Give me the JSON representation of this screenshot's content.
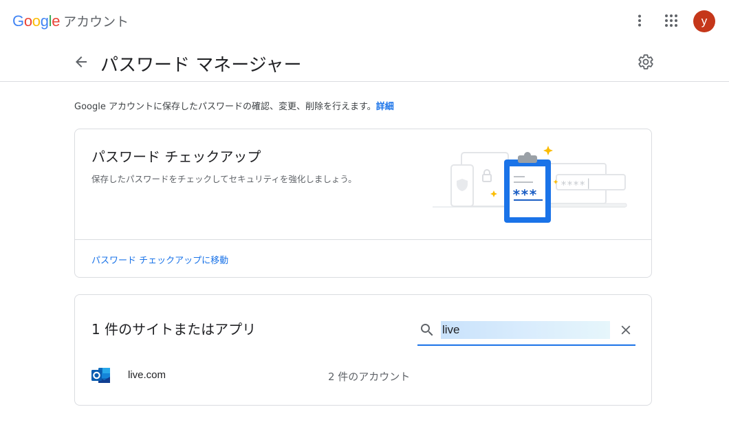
{
  "topbar": {
    "logo_letters": [
      "G",
      "o",
      "o",
      "g",
      "l",
      "e"
    ],
    "product": "アカウント",
    "avatar_letter": "y",
    "icons": [
      "more-vert-icon",
      "apps-grid-icon"
    ]
  },
  "header": {
    "title": "パスワード マネージャー",
    "icons": [
      "arrow-back-icon",
      "gear-icon"
    ]
  },
  "description": {
    "text": "Google アカウントに保存したパスワードの確認、変更、削除を行えます。",
    "link": "詳細"
  },
  "checkup": {
    "title": "パスワード チェックアップ",
    "subtitle": "保存したパスワードをチェックしてセキュリティを強化しましょう。",
    "link": "パスワード チェックアップに移動",
    "illustration": {
      "masked_field": "∗∗∗∗|",
      "clipboard_mask": "∗∗∗"
    }
  },
  "sites": {
    "title": "1 件のサイトまたはアプリ",
    "search_value": "live",
    "items": [
      {
        "name": "live.com",
        "accounts": "2 件のアカウント",
        "icon": "outlook-icon"
      }
    ]
  },
  "colors": {
    "link": "#1a73e8",
    "avatar": "#c5371a",
    "accent_yellow": "#fbbc04",
    "clipboard_blue": "#1a73e8"
  }
}
